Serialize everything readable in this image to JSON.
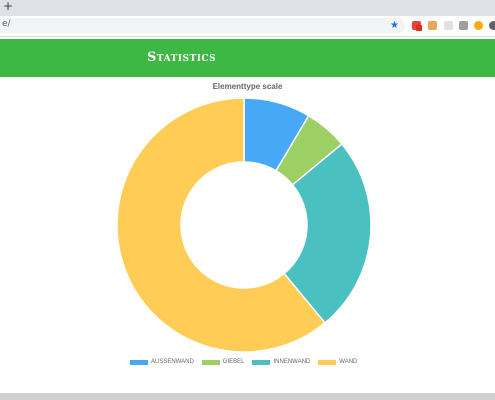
{
  "browser": {
    "new_tab_label": "+",
    "url": "e/"
  },
  "header": {
    "title": "Statistics",
    "background": "#3db843"
  },
  "chart_data": {
    "type": "doughnut",
    "title": "Elementtype scale",
    "categories": [
      "AUSSENWAND",
      "GIEBEL",
      "INNENWAND",
      "WAND"
    ],
    "values": [
      8.5,
      5.5,
      25,
      61
    ],
    "colors": [
      "#47a8f6",
      "#9ccf64",
      "#4bc0c0",
      "#ffcd56"
    ],
    "legend_position": "bottom"
  }
}
